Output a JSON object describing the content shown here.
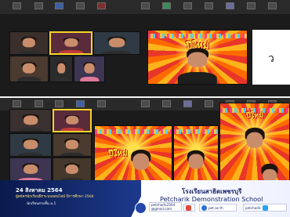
{
  "screens": {
    "top_labels": [
      "",
      "",
      "",
      "",
      "",
      "",
      "",
      "",
      "",
      "",
      "",
      "",
      "",
      ""
    ],
    "mid_labels": [
      "",
      "",
      "",
      "",
      "",
      "",
      "",
      "",
      "",
      "",
      "",
      "",
      "",
      ""
    ]
  },
  "slide_text": "ว",
  "wordart_top": "ปีใหม่",
  "wordart_bl": "ปีใหม่",
  "wordart_br": "ปีใหม่",
  "banner": {
    "date": "24 สิงหาคม 2564",
    "subtitle": "ผู้สมัครนักเรียนฝึกระบบออนไลน์ ปีการศึกษา 2564",
    "level": "นักเรียนสายชั้น ม.1"
  },
  "school": {
    "name_th": "โรงเรียนสาธิตเพชรบุรี",
    "name_en": "Petcharik Demonstration School"
  },
  "contacts": {
    "facebook": "petcharik2564",
    "email": "@gmail.com",
    "website": "pet.ac.th",
    "twitter": "petcharik"
  },
  "colors": {
    "navy": "#17246b",
    "festive_red": "#e8362a",
    "festive_yellow": "#ffdf4a",
    "active_border": "#f5d327"
  }
}
